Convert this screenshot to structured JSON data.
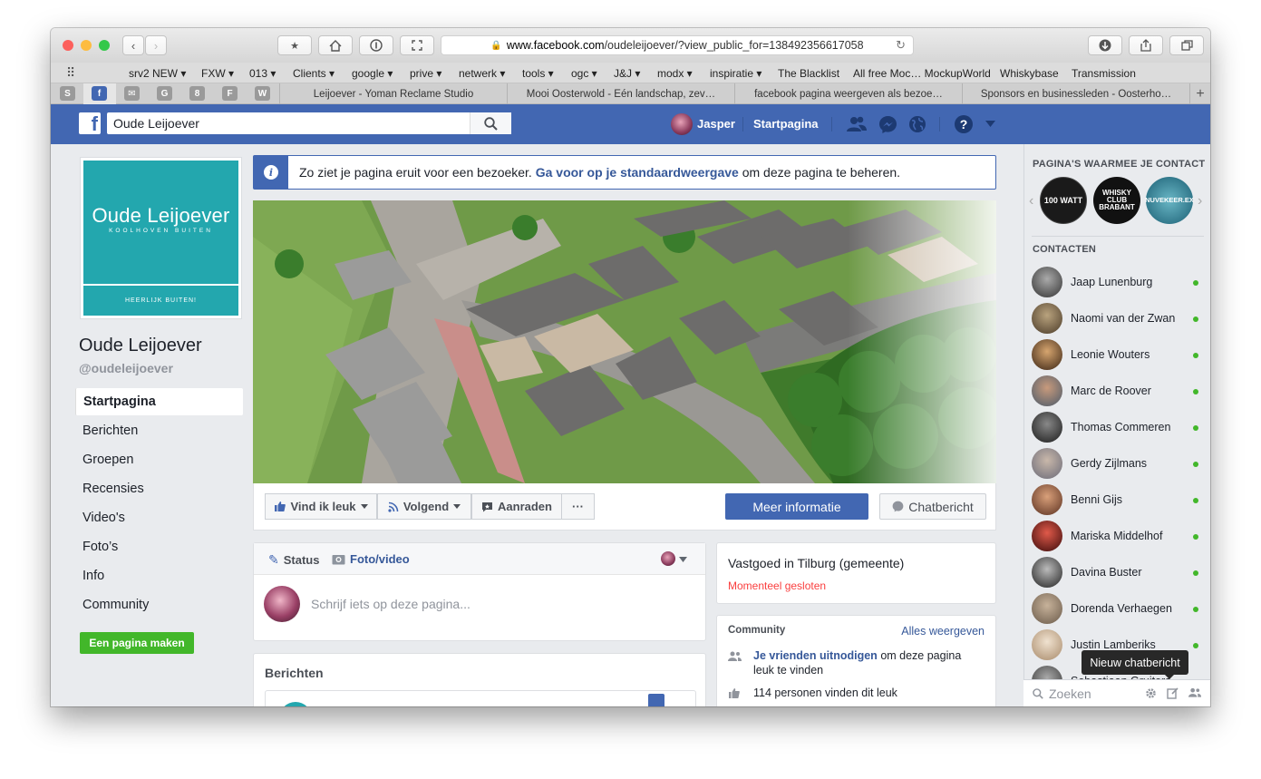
{
  "browser": {
    "url_domain": "www.facebook.com",
    "url_path": "/oudeleijoever/?view_public_for=138492356617058",
    "bookmarks": [
      "srv2 NEW ▾",
      "FXW ▾",
      "013 ▾",
      "Clients ▾",
      "google ▾",
      "prive ▾",
      "netwerk ▾",
      "tools ▾",
      "ogc ▾",
      "J&J ▾",
      "modx ▾",
      "inspiratie ▾",
      "The Blacklist",
      "All free Moc… MockupWorld",
      "Whiskybase",
      "Transmission"
    ],
    "pinned_tabs": [
      "S",
      "f",
      "✉",
      "G",
      "8",
      "F",
      "W"
    ],
    "tabs": [
      "Leijoever - Yoman Reclame Studio",
      "Mooi Oosterwold - Eén landschap, zev…",
      "facebook pagina weergeven als bezoe…",
      "Sponsors en businessleden - Oosterho…"
    ]
  },
  "header": {
    "search_value": "Oude Leijoever",
    "user_name": "Jasper",
    "home_label": "Startpagina"
  },
  "page": {
    "logo_title": "Oude Leijoever",
    "logo_sub": "KOOLHOVEN BUITEN",
    "logo_tagline": "HEERLIJK BUITEN!",
    "name": "Oude Leijoever",
    "handle": "@oudeleijoever",
    "nav": [
      "Startpagina",
      "Berichten",
      "Groepen",
      "Recensies",
      "Video's",
      "Foto’s",
      "Info",
      "Community"
    ],
    "create_page": "Een pagina maken"
  },
  "notice": {
    "text": "Zo ziet je pagina eruit voor een bezoeker.",
    "link": "Ga voor op je standaardweergave",
    "after": "om deze pagina te beheren."
  },
  "actions": {
    "like": "Vind ik leuk",
    "follow": "Volgend",
    "recommend": "Aanraden",
    "more": "···",
    "primary": "Meer informatie",
    "message": "Chatbericht"
  },
  "composer": {
    "status": "Status",
    "photo": "Foto/video",
    "placeholder": "Schrijf iets op deze pagina..."
  },
  "posts_title": "Berichten",
  "place": {
    "category": "Vastgoed in Tilburg (gemeente)",
    "status": "Momenteel gesloten"
  },
  "community": {
    "title": "Community",
    "see_all": "Alles weergeven",
    "invite_link": "Je vrienden uitnodigen",
    "invite_rest_1": "om deze pagina",
    "invite_rest_2": "leuk te vinden",
    "likes": "114 personen vinden dit leuk"
  },
  "sidebar": {
    "pages_title": "PAGINA'S WAARMEE JE CONTACT",
    "pages": [
      "100 WATT",
      "WHISKY CLUB BRABANT",
      "NUVEKEER.EX"
    ],
    "contacts_title": "CONTACTEN",
    "contacts": [
      "Jaap Lunenburg",
      "Naomi van der Zwan",
      "Leonie Wouters",
      "Marc de Roover",
      "Thomas Commeren",
      "Gerdy Zijlmans",
      "Benni Gijs",
      "Mariska Middelhof",
      "Davina Buster",
      "Dorenda Verhaegen",
      "Justin Lamberiks",
      "Sebastiaan Gruiters"
    ],
    "tooltip": "Nieuw chatbericht",
    "search_placeholder": "Zoeken"
  },
  "colors": {
    "fb_blue": "#4267b2",
    "green": "#42b72a",
    "teal": "#23a7ae",
    "closed_red": "#fa3e3e"
  }
}
